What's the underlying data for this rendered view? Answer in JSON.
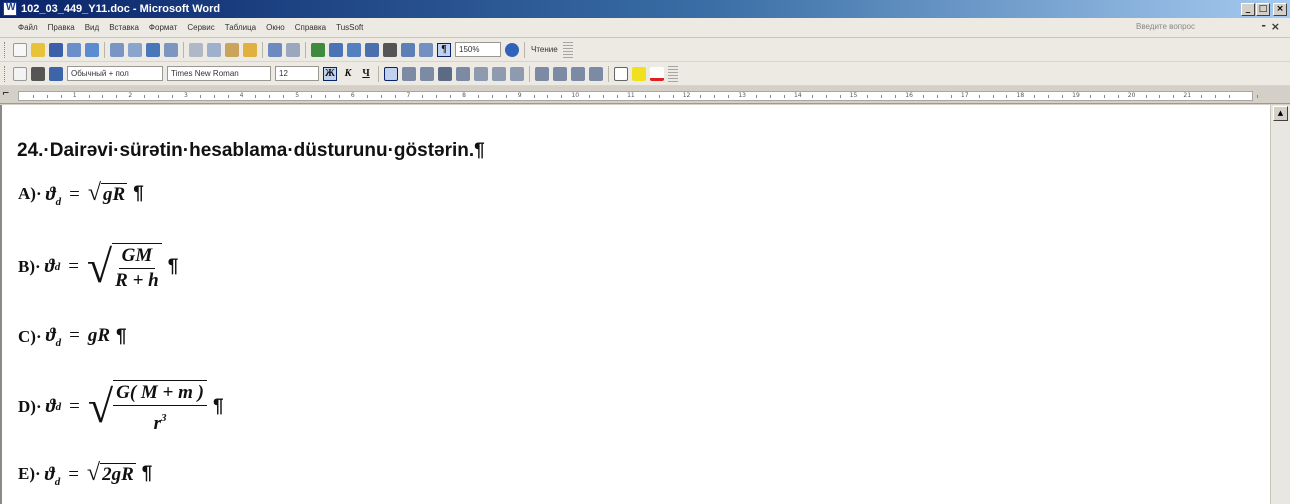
{
  "window": {
    "title": "102_03_449_Y11.doc - Microsoft Word",
    "minimize": "_",
    "maximize": "□",
    "close": "×"
  },
  "menu": {
    "items": [
      "Файл",
      "Правка",
      "Вид",
      "Вставка",
      "Формат",
      "Сервис",
      "Таблица",
      "Окно",
      "Справка",
      "TusSoft"
    ],
    "ask_placeholder": "Введите вопрос",
    "doc_close": "×",
    "doc_minimize": "-"
  },
  "toolbar_standard": {
    "zoom": "150%",
    "reading_label": "Чтение"
  },
  "toolbar_formatting": {
    "style": "Обычный + пол",
    "font": "Times New Roman",
    "size": "12",
    "bold": "Ж",
    "italic": "К",
    "underline": "Ч"
  },
  "ruler": {
    "numbers": [
      "1",
      "2",
      "3",
      "4",
      "5",
      "6",
      "7",
      "8",
      "9",
      "10",
      "11",
      "12",
      "13",
      "14",
      "15",
      "16",
      "17",
      "18",
      "19",
      "20",
      "21"
    ]
  },
  "document": {
    "question": "24.·Dairəvi·sürətin·hesablama·düsturunu·göstərin.¶",
    "options": [
      {
        "label": "A)·",
        "var": "ϑ",
        "sub": "d",
        "formula": "√gR"
      },
      {
        "label": "B)·",
        "var": "ϑ",
        "sub": "d",
        "formula": "√(GM/(R+h))"
      },
      {
        "label": "C)·",
        "var": "ϑ",
        "sub": "d",
        "formula": "gR"
      },
      {
        "label": "D)·",
        "var": "ϑ",
        "sub": "d",
        "formula": "√(G(M+m)/r³)"
      },
      {
        "label": "E)·",
        "var": "ϑ",
        "sub": "d",
        "formula": "√2gR"
      }
    ],
    "pilcrow": "¶"
  },
  "colors": {
    "titlebar": "#0a246a",
    "chrome": "#eceae3",
    "page": "#ffffff"
  }
}
